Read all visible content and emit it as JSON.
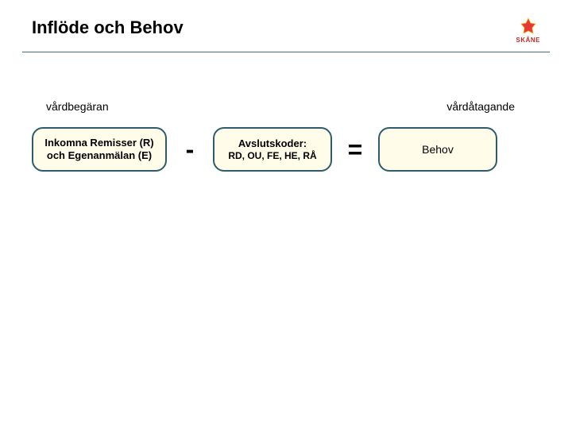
{
  "header": {
    "title": "Inflöde och Behov",
    "logo_text": "SKÅNE"
  },
  "labels": {
    "left": "vårdbegäran",
    "right": "vårdåtagande"
  },
  "equation": {
    "box1_line1": "Inkomna Remisser (R)",
    "box1_line2": "och Egenanmälan (E)",
    "op1": "-",
    "box2_line1": "Avslutskoder:",
    "box2_line2": "RD, OU, FE, HE, RÅ",
    "op2": "=",
    "box3": "Behov"
  }
}
